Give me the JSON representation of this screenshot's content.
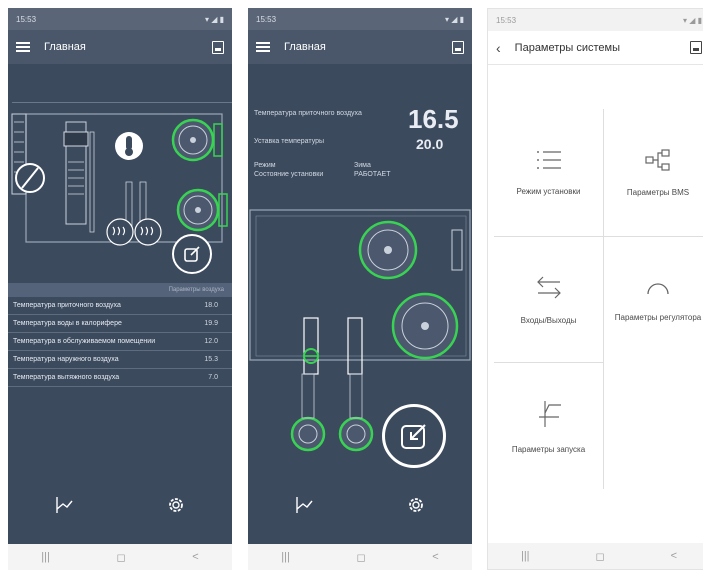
{
  "statusbar": {
    "time": "15:53",
    "right": "▾ ◢ ▮"
  },
  "phone1": {
    "title": "Главная",
    "table_header": "Параметры воздуха",
    "rows": [
      {
        "label": "Температура приточного воздуха",
        "value": "18.0"
      },
      {
        "label": "Температура воды в калорифере",
        "value": "19.9"
      },
      {
        "label": "Температура в обслуживаемом помещении",
        "value": "12.0"
      },
      {
        "label": "Температура наружного воздуха",
        "value": "15.3"
      },
      {
        "label": "Температура вытяжного воздуха",
        "value": "7.0"
      }
    ]
  },
  "phone2": {
    "title": "Главная",
    "supply_temp_label": "Температура приточного воздуха",
    "supply_temp_value": "16.5",
    "setpoint_label": "Уставка температуры",
    "setpoint_value": "20.0",
    "mode_label": "Режим",
    "state_label": "Состояние установки",
    "season_value": "Зима",
    "state_value": "РАБОТАЕТ"
  },
  "phone3": {
    "title": "Параметры системы",
    "items": [
      {
        "label": "Режим установки",
        "icon": "list-icon"
      },
      {
        "label": "Параметры BMS",
        "icon": "network-icon"
      },
      {
        "label": "Входы/Выходы",
        "icon": "arrows-icon"
      },
      {
        "label": "Параметры регулятора",
        "icon": "gauge-icon"
      },
      {
        "label": "Параметры запуска",
        "icon": "start-icon"
      }
    ]
  },
  "navbar": {
    "recent": "|||",
    "home": "◻",
    "back": "<"
  },
  "colors": {
    "panel": "#3c4a5e",
    "accent": "#39d353",
    "text": "#e9edf3"
  }
}
